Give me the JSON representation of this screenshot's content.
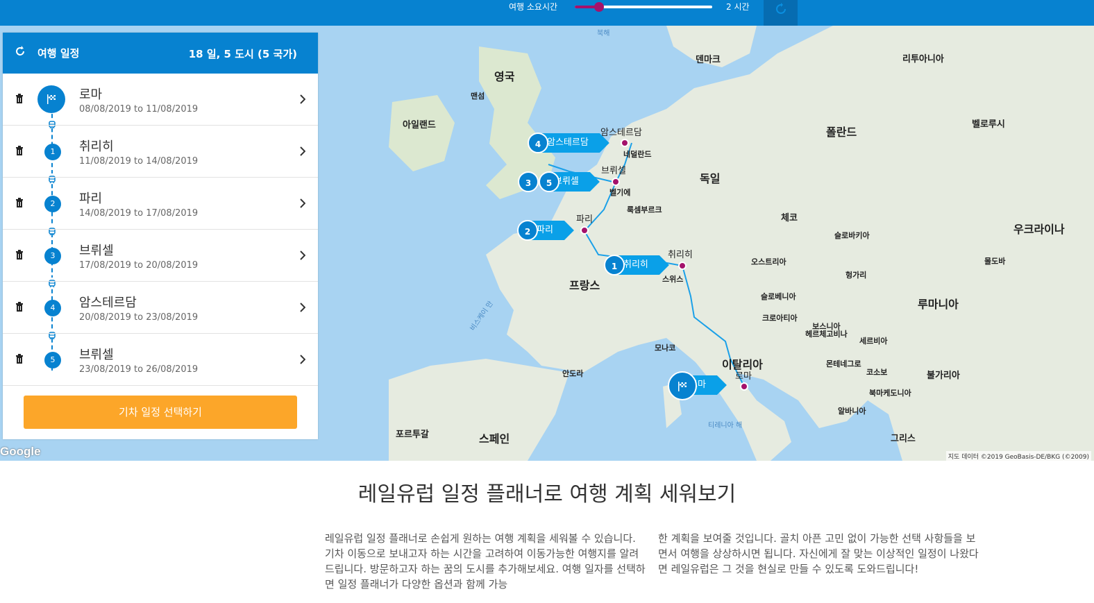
{
  "topbar": {
    "duration_label": "여행 소요시간",
    "duration_value": "2 시간",
    "duration_fraction": 0.18,
    "accent": "#a4126b"
  },
  "panel": {
    "title": "여행 일정",
    "summary": "18 일, 5 도시 (5 국가)",
    "stops": [
      {
        "badge": "",
        "city": "로마",
        "dates": "08/08/2019 to 11/08/2019"
      },
      {
        "badge": "1",
        "city": "취리히",
        "dates": "11/08/2019 to 14/08/2019"
      },
      {
        "badge": "2",
        "city": "파리",
        "dates": "14/08/2019 to 17/08/2019"
      },
      {
        "badge": "3",
        "city": "브뤼셀",
        "dates": "17/08/2019 to 20/08/2019"
      },
      {
        "badge": "4",
        "city": "암스테르담",
        "dates": "20/08/2019 to 23/08/2019"
      },
      {
        "badge": "5",
        "city": "브뤼셀",
        "dates": "23/08/2019 to 26/08/2019"
      }
    ],
    "cta": "기차 일정 선택하기"
  },
  "map": {
    "labels": {
      "uk": "영국",
      "ireland": "아일랜드",
      "man": "맨섬",
      "denmark": "덴마크",
      "lithuania": "리투아니아",
      "poland": "폴란드",
      "belarus": "벨로루시",
      "germany": "독일",
      "netherlands": "네덜란드",
      "belgium": "벨기에",
      "luxembourg": "룩셈부르크",
      "czech": "체코",
      "slovakia": "슬로바키아",
      "ukraine": "우크라이나",
      "austria": "오스트리아",
      "hungary": "헝가리",
      "moldova": "몰도바",
      "france": "프랑스",
      "switzerland": "스위스",
      "slovenia": "슬로베니아",
      "croatia": "크로아티아",
      "romania": "루마니아",
      "bosnia": "보스니아\n헤르체고비나",
      "serbia": "세르비아",
      "monaco": "모나코",
      "andorra": "안도라",
      "italy": "이탈리아",
      "montenegro": "몬테네그로",
      "kosovo": "코소보",
      "bulgaria": "불가리아",
      "macedonia": "북마케도니아",
      "albania": "알바니아",
      "portugal": "포르투갈",
      "spain": "스페인",
      "greece": "그리스",
      "north_sea": "북해",
      "bay": "비스케이 만",
      "tyrrhenian": "티레니아 해",
      "city_amsterdam": "암스테르담",
      "city_brussels": "브뤼셀",
      "city_paris": "파리",
      "city_zurich": "취리히",
      "city_rome": "로마"
    },
    "pins": {
      "amsterdam": {
        "badges": [
          "4"
        ],
        "label": "암스테르담"
      },
      "brussels": {
        "badges": [
          "3",
          "5"
        ],
        "label": "브뤼셀"
      },
      "paris": {
        "badges": [
          "2"
        ],
        "label": "파리"
      },
      "zurich": {
        "badges": [
          "1"
        ],
        "label": "취리히"
      },
      "rome": {
        "badges": [
          ""
        ],
        "label": "로마"
      }
    },
    "google": "Google",
    "attribution": "지도 데이터 ©2019 GeoBasis-DE/BKG (©2009)"
  },
  "content": {
    "headline": "레일유럽 일정 플래너로 여행 계획 세워보기",
    "para_left": "레일유럽 일정 플래너로 손쉽게 원하는 여행 계획을 세워볼 수 있습니다. 기차 이동으로 보내고자 하는 시간을 고려하여 이동가능한 여행지를 알려드립니다. 방문하고자 하는 꿈의 도시를 추가해보세요. 여행 일자를 선택하면 일정 플래너가 다양한 옵션과 함께 가능",
    "para_right": "한 계획을 보여줄 것입니다. 골치 아픈 고민 없이 가능한 선택 사항들을 보면서 여행을 상상하시면 됩니다. 자신에게 잘 맞는 이상적인 일정이 나왔다면 레일유럽은 그 것을 현실로 만들 수 있도록 도와드립니다!"
  }
}
